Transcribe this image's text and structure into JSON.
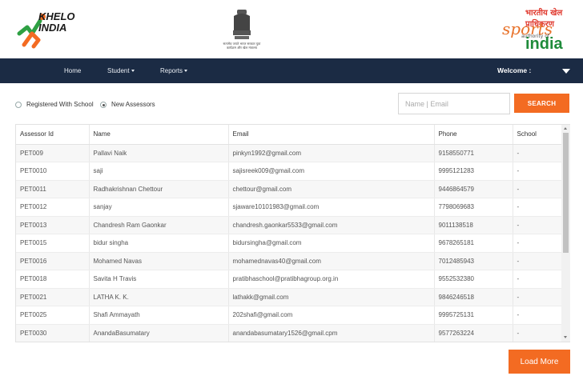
{
  "header": {
    "khelo_logo_text": "KHELO INDIA",
    "emblem_caption": "सत्यमेव जयते भारत सरकार युवा कार्यक्रम और खेल मंत्रालय",
    "sai_hindi": "भारतीय खेल प्राधिकरण",
    "sai_sports": "sports",
    "sai_authority": "authority of",
    "sai_india": "india"
  },
  "nav": {
    "home": "Home",
    "student": "Student",
    "reports": "Reports",
    "welcome": "Welcome :"
  },
  "filters": {
    "option_registered": "Registered With School",
    "option_new": "New Assessors",
    "selected": "New Assessors"
  },
  "search": {
    "placeholder": "Name | Email",
    "value": "",
    "button": "SEARCH"
  },
  "table": {
    "columns": [
      "Assessor Id",
      "Name",
      "Email",
      "Phone",
      "School"
    ],
    "rows": [
      [
        "PET009",
        "Pallavi Naik",
        "pinkyn1992@gmail.com",
        "9158550771",
        "-"
      ],
      [
        "PET0010",
        "saji",
        "sajisreek009@gmail.com",
        "9995121283",
        "-"
      ],
      [
        "PET0011",
        "Radhakrishnan Chettour",
        "chettour@gmail.com",
        "9446864579",
        "-"
      ],
      [
        "PET0012",
        "sanjay",
        "sjaware10101983@gmail.com",
        "7798069683",
        "-"
      ],
      [
        "PET0013",
        "Chandresh Ram Gaonkar",
        "chandresh.gaonkar5533@gmail.com",
        "9011138518",
        "-"
      ],
      [
        "PET0015",
        "bidur singha",
        "bidursingha@gmail.com",
        "9678265181",
        "-"
      ],
      [
        "PET0016",
        "Mohamed Navas",
        "mohamednavas40@gmail.com",
        "7012485943",
        "-"
      ],
      [
        "PET0018",
        "Savita H Travis",
        "pratibhaschool@pratibhagroup.org.in",
        "9552532380",
        "-"
      ],
      [
        "PET0021",
        "LATHA K. K.",
        "lathakk@gmail.com",
        "9846246518",
        "-"
      ],
      [
        "PET0025",
        "Shafi Ammayath",
        "202shafi@gmail.com",
        "9995725131",
        "-"
      ],
      [
        "PET0030",
        "AnandaBasumatary",
        "anandabasumatary1526@gmail.cpm",
        "9577263224",
        "-"
      ]
    ]
  },
  "load_more": "Load More",
  "colors": {
    "accent": "#f36b22",
    "navbar": "#1b2b44"
  }
}
